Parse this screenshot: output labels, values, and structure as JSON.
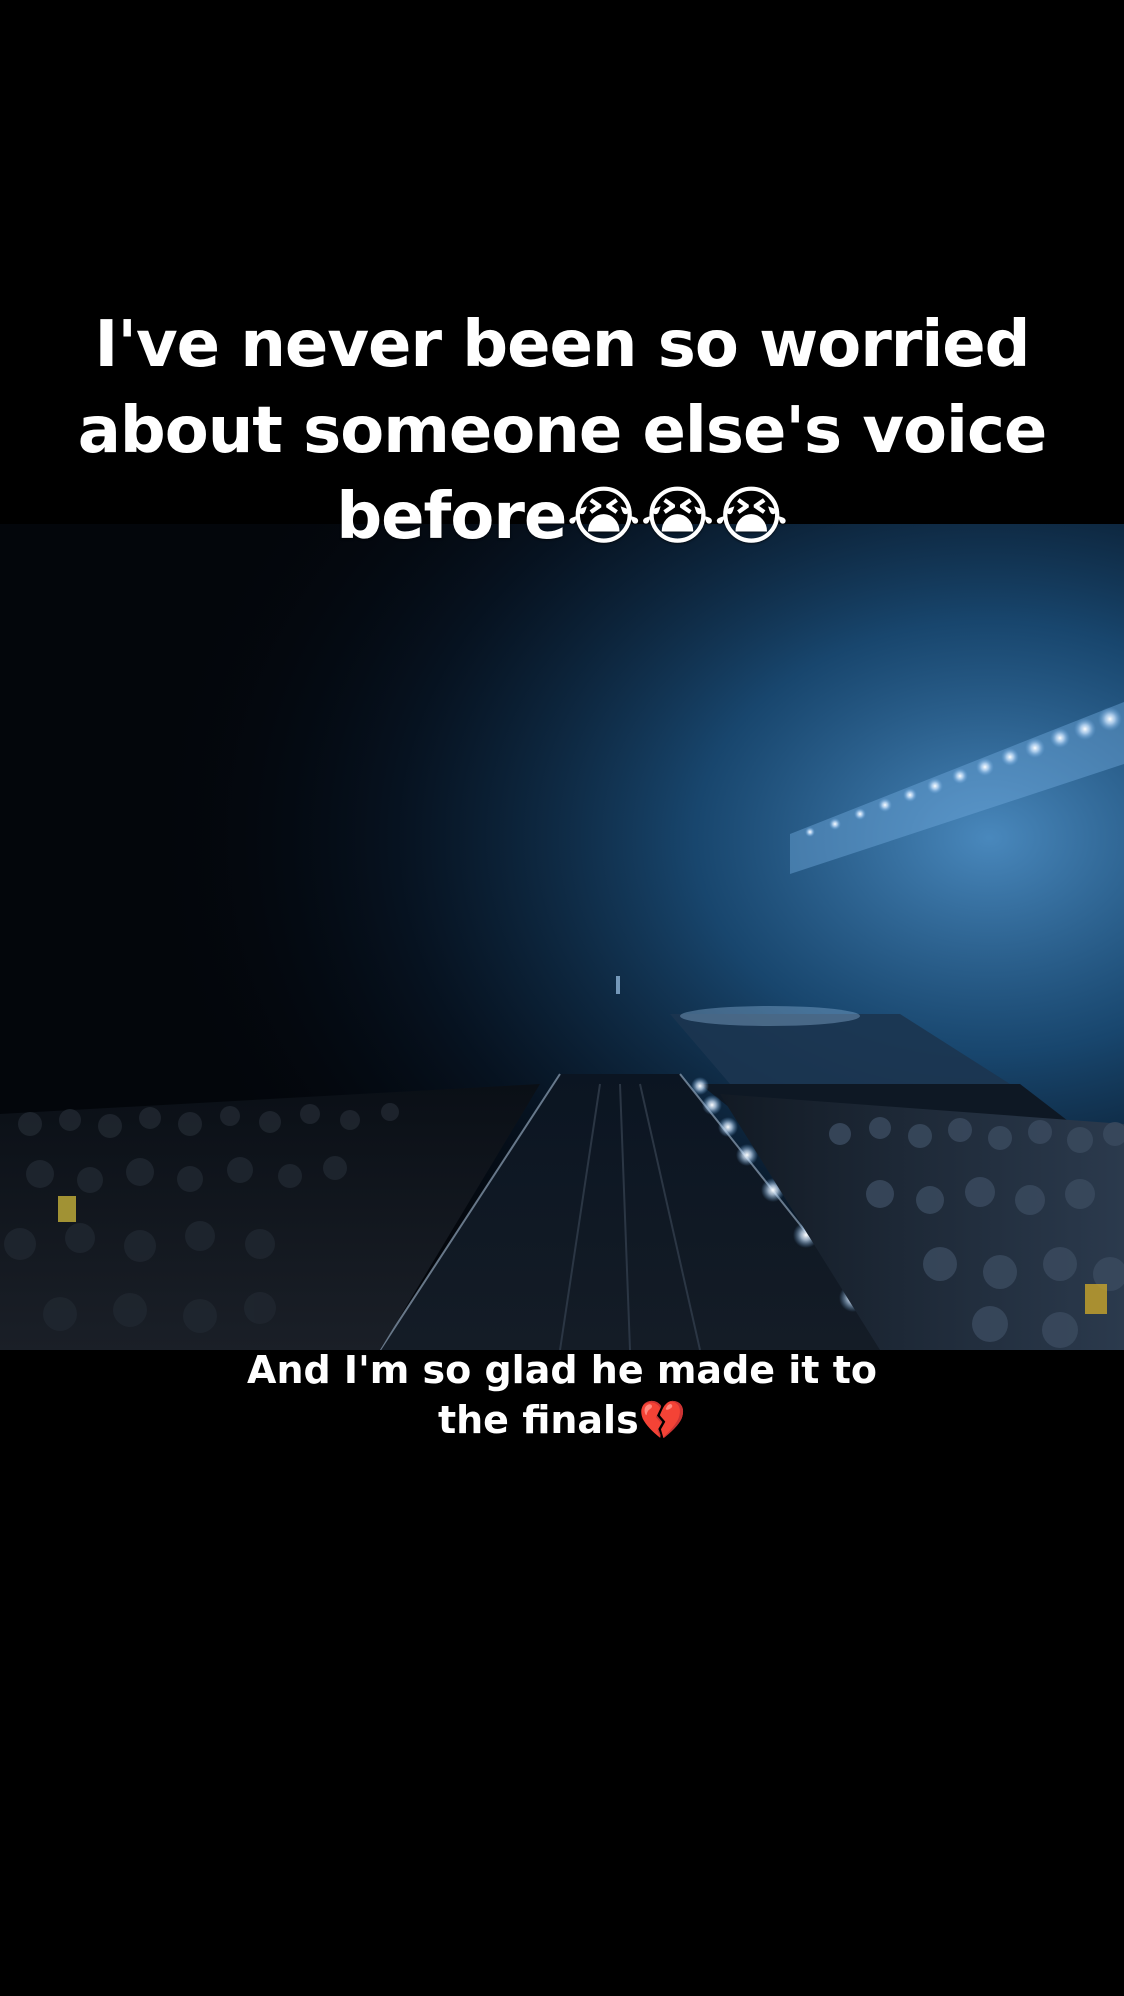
{
  "overlay": {
    "top_caption_lines": [
      "I've never been so worried",
      "about someone else's voice",
      "before😭😭😭"
    ],
    "bottom_caption_lines": [
      "And I'm so glad he made it to",
      "the finals💔"
    ]
  },
  "colors": {
    "background": "#000000",
    "caption_text": "#ffffff",
    "stage_light": "#bfe0ff",
    "haze_blue": "#2a6fa8"
  }
}
